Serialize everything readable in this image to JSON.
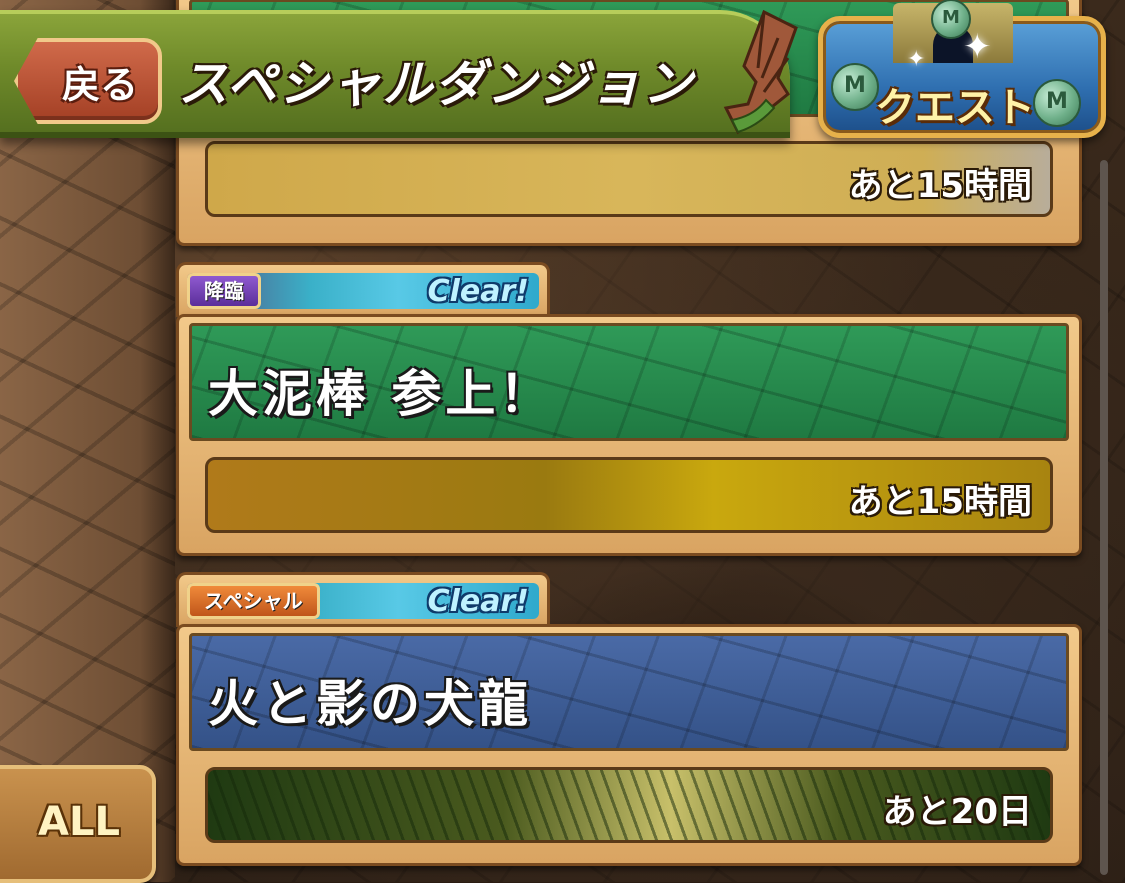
{
  "header": {
    "back_label": "戻る",
    "title": "スペシャルダンジョン",
    "quest_label": "クエスト"
  },
  "dungeons": [
    {
      "time_left": "あと15時間"
    },
    {
      "badge": "降臨",
      "status": "Clear!",
      "name": "大泥棒 参上！",
      "time_left": "あと15時間"
    },
    {
      "badge": "スペシャル",
      "status": "Clear!",
      "name": "火と影の犬龍",
      "time_left": "あと20日"
    }
  ],
  "filter": {
    "all_label": "ALL"
  },
  "colors": {
    "header_green": "#6f8a2a",
    "card_frame": "#d9a462",
    "banner_green": "#1f7a42",
    "banner_blue": "#345288",
    "clear_cyan": "#58c9e6"
  }
}
